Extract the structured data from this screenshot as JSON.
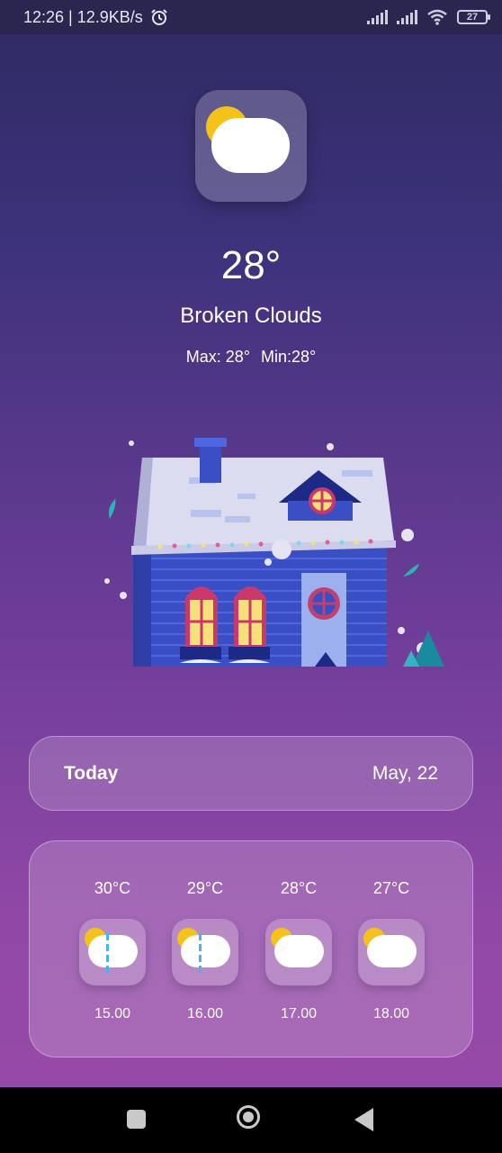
{
  "status_bar": {
    "time_speed": "12:26 | 12.9KB/s",
    "battery": "27"
  },
  "current": {
    "icon": "sun-behind-cloud-icon",
    "temperature": "28°",
    "condition": "Broken Clouds",
    "max": "Max: 28°",
    "min": "Min:28°"
  },
  "illustration": "snowy-house-illustration",
  "today": {
    "label": "Today",
    "date": "May, 22"
  },
  "hourly": [
    {
      "temp": "30°C",
      "time": "15.00",
      "icon": "sun-cloud-rain-icon"
    },
    {
      "temp": "29°C",
      "time": "16.00",
      "icon": "sun-cloud-rain-icon"
    },
    {
      "temp": "28°C",
      "time": "17.00",
      "icon": "sun-cloud-icon"
    },
    {
      "temp": "27°C",
      "time": "18.00",
      "icon": "sun-cloud-icon"
    }
  ],
  "colors": {
    "sun": "#f4c21a",
    "rain": "#4ab3e8",
    "background_top": "#2f2a62",
    "background_bottom": "#9a4aa8"
  }
}
